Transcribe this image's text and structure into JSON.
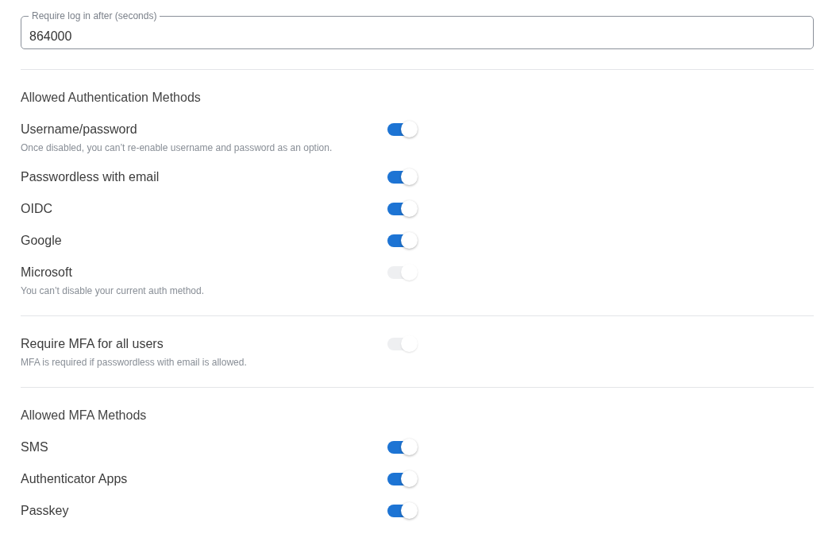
{
  "login_timeout": {
    "label": "Require log in after (seconds)",
    "value": "864000"
  },
  "sections": [
    {
      "heading": "Allowed Authentication Methods",
      "toggles": [
        {
          "label": "Username/password",
          "on": true,
          "disabled": false,
          "hint": "Once disabled, you can’t re-enable username and password as an option."
        },
        {
          "label": "Passwordless with email",
          "on": true,
          "disabled": false
        },
        {
          "label": "OIDC",
          "on": true,
          "disabled": false
        },
        {
          "label": "Google",
          "on": true,
          "disabled": false
        },
        {
          "label": "Microsoft",
          "on": true,
          "disabled": true,
          "hint": "You can’t disable your current auth method."
        }
      ]
    },
    {
      "toggles": [
        {
          "label": "Require MFA for all users",
          "on": true,
          "disabled": true,
          "hint": "MFA is required if passwordless with email is allowed."
        }
      ]
    },
    {
      "heading": "Allowed MFA Methods",
      "toggles": [
        {
          "label": "SMS",
          "on": true,
          "disabled": false
        },
        {
          "label": "Authenticator Apps",
          "on": true,
          "disabled": false
        },
        {
          "label": "Passkey",
          "on": true,
          "disabled": false
        }
      ]
    }
  ]
}
